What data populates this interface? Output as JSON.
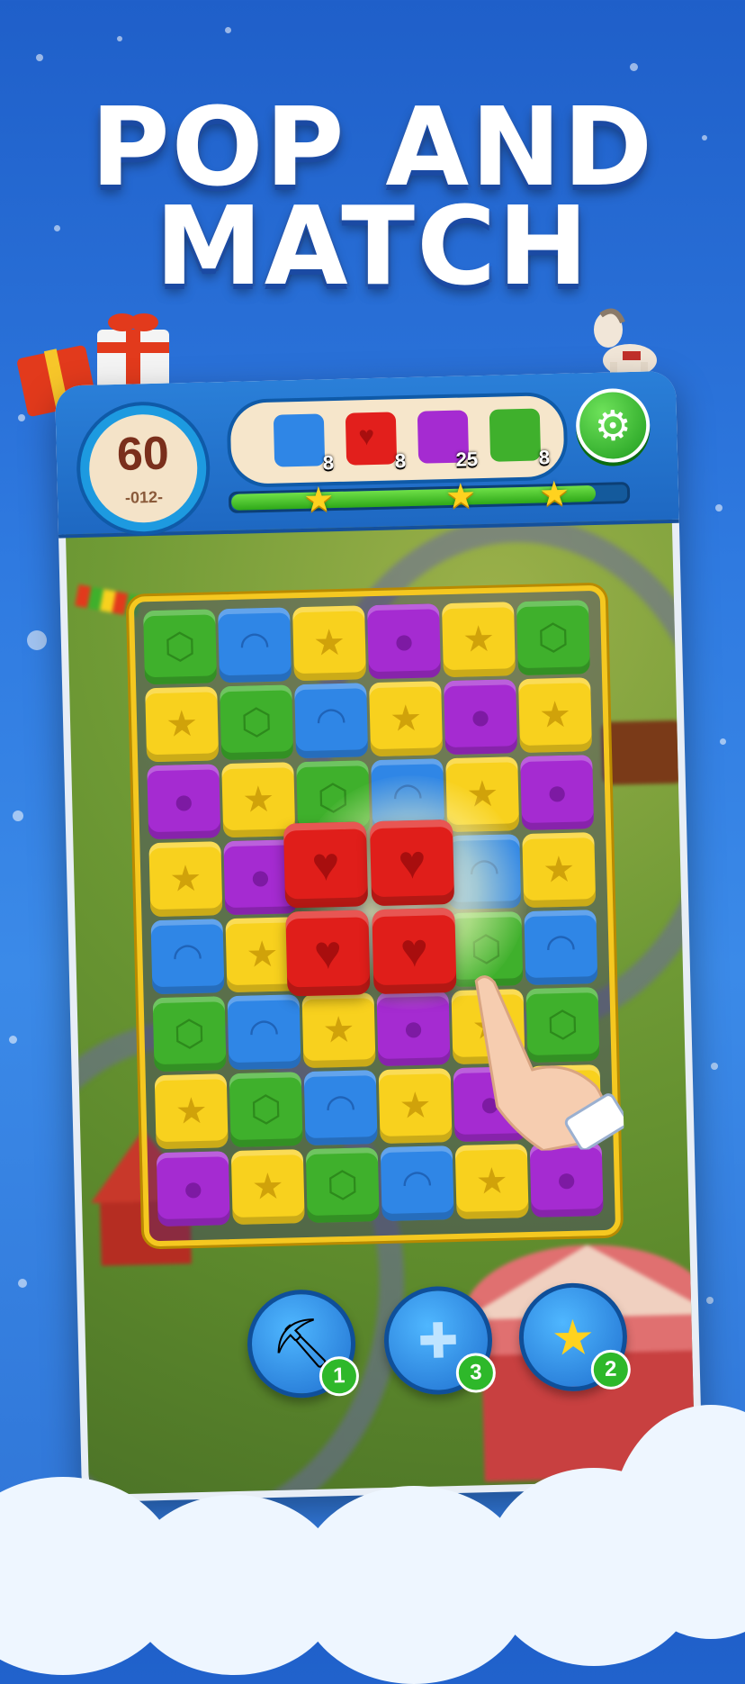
{
  "headline": {
    "line1": "POP AND",
    "line2": "MATCH"
  },
  "hud": {
    "moves": "60",
    "level": "-012-",
    "goals": [
      {
        "color": "blue",
        "count": "8"
      },
      {
        "color": "red",
        "count": "8"
      },
      {
        "color": "purple",
        "count": "25"
      },
      {
        "color": "green",
        "count": "8"
      }
    ],
    "progress": 0.92,
    "stars": 3,
    "settings_icon": "gear-icon"
  },
  "board": {
    "rows": [
      [
        "green",
        "blue",
        "yellow",
        "purple",
        "yellow",
        "green"
      ],
      [
        "yellow",
        "green",
        "blue",
        "yellow",
        "purple",
        "yellow"
      ],
      [
        "purple",
        "yellow",
        "green",
        "blue",
        "yellow",
        "purple"
      ],
      [
        "yellow",
        "purple",
        "red",
        "red",
        "blue",
        "yellow"
      ],
      [
        "blue",
        "yellow",
        "red",
        "red",
        "green",
        "blue"
      ],
      [
        "green",
        "blue",
        "yellow",
        "purple",
        "yellow",
        "green"
      ],
      [
        "yellow",
        "green",
        "blue",
        "yellow",
        "purple",
        "yellow"
      ],
      [
        "purple",
        "yellow",
        "green",
        "blue",
        "yellow",
        "purple"
      ]
    ],
    "highlighted_group": "red"
  },
  "boosters": [
    {
      "icon": "shovel-icon",
      "count": "1"
    },
    {
      "icon": "cross-pipe-icon",
      "count": "3"
    },
    {
      "icon": "star-wand-icon",
      "count": "2"
    }
  ],
  "colors": {
    "green": "#3fb02c",
    "blue": "#2f86e6",
    "yellow": "#f8d11e",
    "purple": "#a52bd1",
    "red": "#e21f1c",
    "accent": "#1d9ae0"
  }
}
